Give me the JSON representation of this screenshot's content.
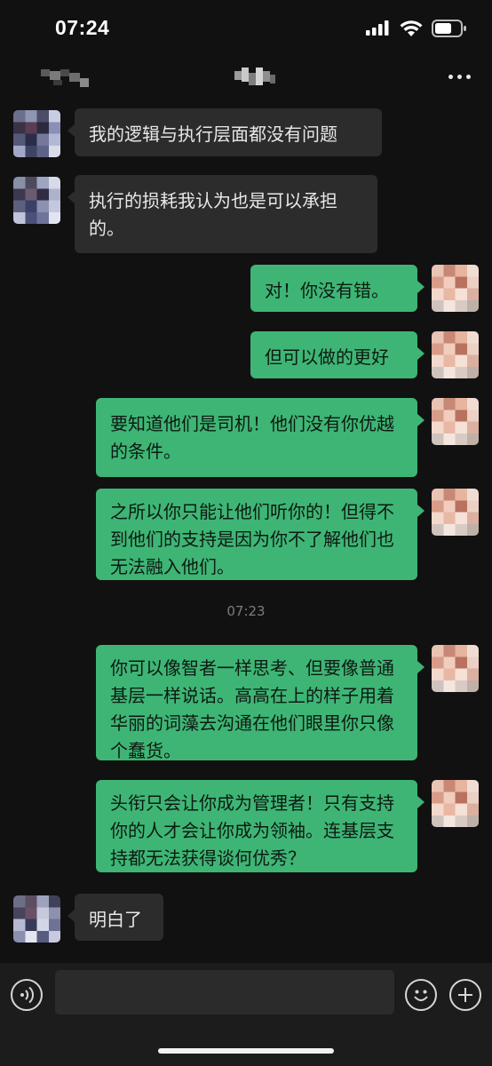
{
  "status_bar": {
    "time": "07:24",
    "icons": [
      "signal-icon",
      "wifi-icon",
      "battery-icon"
    ]
  },
  "nav": {
    "more_icon": "more-icon"
  },
  "messages": [
    {
      "side": "in",
      "text": "我的逻辑与执行层面都没有问题"
    },
    {
      "side": "in",
      "text": "执行的损耗我认为也是可以承担的。"
    },
    {
      "side": "out",
      "text": "对！你没有错。"
    },
    {
      "side": "out",
      "text": "但可以做的更好"
    },
    {
      "side": "out",
      "text": "要知道他们是司机！他们没有你优越的条件。"
    },
    {
      "side": "out",
      "text": "之所以你只能让他们听你的！但得不到他们的支持是因为你不了解他们也无法融入他们。"
    },
    {
      "side": "out",
      "text": "你可以像智者一样思考、但要像普通基层一样说话。高高在上的样子用着华丽的词藻去沟通在他们眼里你只像个蠢货。"
    },
    {
      "side": "out",
      "text": "头衔只会让你成为管理者！只有支持你的人才会让你成为领袖。连基层支持都无法获得谈何优秀？"
    },
    {
      "side": "in",
      "text": "明白了"
    }
  ],
  "timestamp": "07:23",
  "input_bar": {
    "placeholder": "",
    "voice_icon": "voice-icon",
    "emoji_icon": "emoji-icon",
    "plus_icon": "plus-icon"
  },
  "colors": {
    "background": "#111111",
    "incoming_bubble": "#2c2c2c",
    "outgoing_bubble": "#3eb575",
    "timestamp": "#7d7d7d"
  }
}
